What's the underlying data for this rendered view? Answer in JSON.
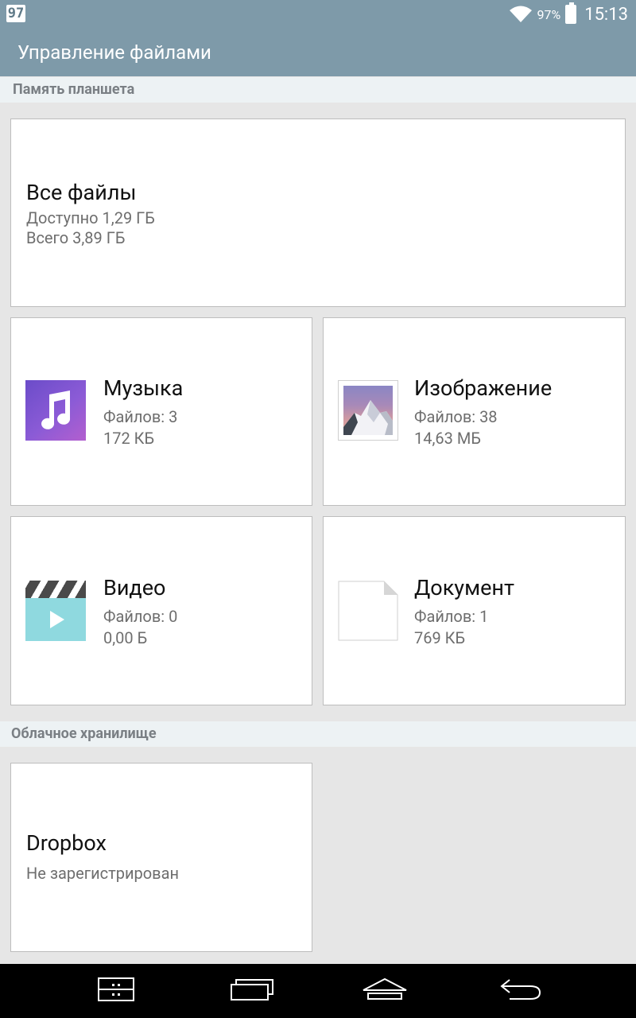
{
  "status_bar": {
    "badge": "97",
    "battery_percent": "97%",
    "time": "15:13"
  },
  "app_bar": {
    "title": "Управление файлами"
  },
  "sections": {
    "tablet_memory": "Память планшета",
    "cloud_storage": "Облачное хранилище"
  },
  "all_files": {
    "title": "Все файлы",
    "available": "Доступно 1,29 ГБ",
    "total": "Всего 3,89 ГБ"
  },
  "categories": {
    "music": {
      "title": "Музыка",
      "count": "Файлов: 3",
      "size": "172 КБ",
      "icon": "music-note-icon"
    },
    "images": {
      "title": "Изображение",
      "count": "Файлов: 38",
      "size": "14,63 МБ",
      "icon": "mountain-image-icon"
    },
    "video": {
      "title": "Видео",
      "count": "Файлов: 0",
      "size": "0,00 Б",
      "icon": "clapperboard-play-icon"
    },
    "documents": {
      "title": "Документ",
      "count": "Файлов: 1",
      "size": "769 КБ",
      "icon": "document-page-icon"
    }
  },
  "cloud": {
    "dropbox": {
      "title": "Dropbox",
      "status": "Не зарегистрирован"
    }
  },
  "colors": {
    "header": "#7e9aa9",
    "background": "#e6e6e6",
    "section_bg": "#edf2f4"
  }
}
